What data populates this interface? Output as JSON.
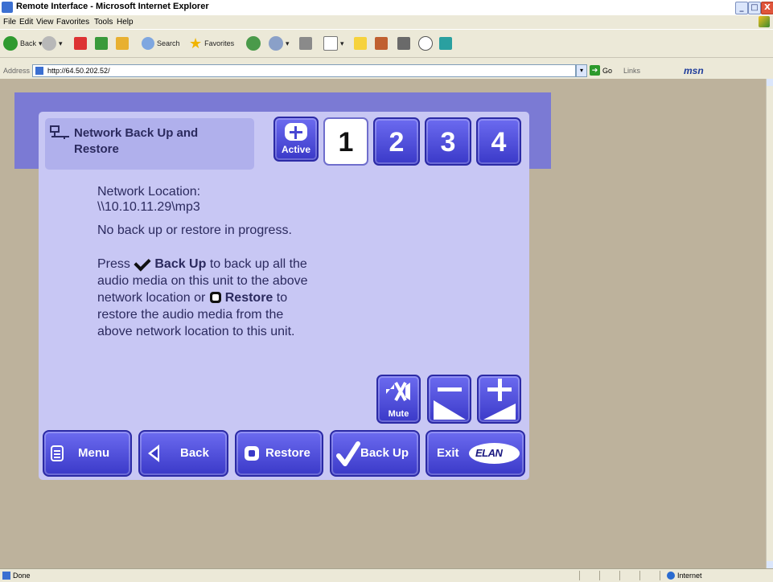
{
  "window": {
    "title": "Remote Interface - Microsoft Internet Explorer",
    "controls": [
      "_",
      "□",
      "X"
    ]
  },
  "menubar": [
    "File",
    "Edit",
    "View",
    "Favorites",
    "Tools",
    "Help"
  ],
  "toolbar": {
    "back": "Back",
    "search": "Search",
    "favorites": "Favorites"
  },
  "addressbar": {
    "label": "Address",
    "url": "http://64.50.202.52/",
    "go": "Go",
    "links": "Links",
    "msn": "msn"
  },
  "statusbar": {
    "status": "Done",
    "zone": "Internet"
  },
  "panel": {
    "header_title": "Network Back Up and Restore",
    "active_label": "Active",
    "zones": [
      "1",
      "2",
      "3",
      "4"
    ],
    "selected_zone": "1",
    "network_location_label": "Network Location:",
    "network_location_value": "\\\\10.10.11.29\\mp3",
    "status_message": "No back up or restore in progress.",
    "instructions": {
      "press": "Press",
      "backup": "Back Up",
      "line1_rest": "to back up all the",
      "line2": "audio media on this unit to the above",
      "line3_pre": "network location or",
      "restore": "Restore",
      "line3_post": "to",
      "line4": "restore the audio media from the",
      "line5": "above network location to this unit."
    },
    "mute_label": "Mute",
    "buttons": {
      "menu": "Menu",
      "back": "Back",
      "restore": "Restore",
      "backup": "Back Up",
      "exit": "Exit",
      "logo": "ELAN"
    }
  },
  "colors": {
    "panel_bg": "#c8c7f4",
    "button_blue": "#4847d2",
    "band": "#7b7ad4",
    "page_bg": "#bdb29c"
  }
}
